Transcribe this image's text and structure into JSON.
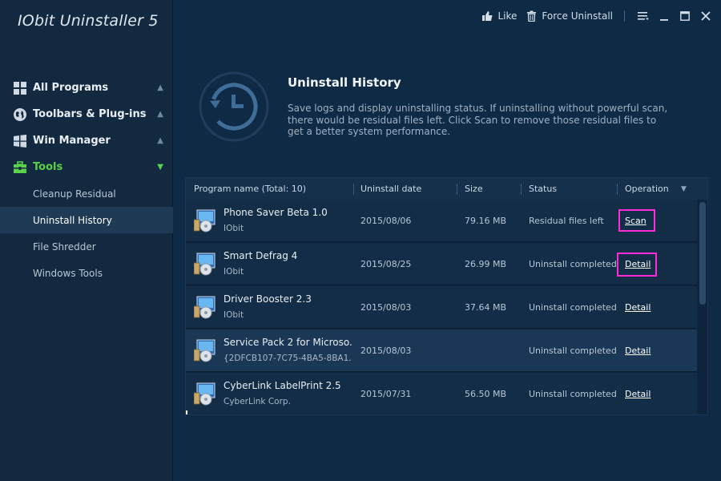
{
  "app": {
    "title": "IObit Uninstaller 5"
  },
  "topbar": {
    "like": "Like",
    "force_uninstall": "Force Uninstall"
  },
  "nav": {
    "items": [
      {
        "label": "All Programs",
        "icon": "windows-grid-icon",
        "arrow": "▲"
      },
      {
        "label": "Toolbars & Plug-ins",
        "icon": "globe-icon",
        "arrow": "▲"
      },
      {
        "label": "Win Manager",
        "icon": "windows-logo-icon",
        "arrow": "▲"
      },
      {
        "label": "Tools",
        "icon": "toolbox-icon",
        "arrow": "▼"
      }
    ],
    "sub_items": [
      {
        "label": "Cleanup Residual"
      },
      {
        "label": "Uninstall History"
      },
      {
        "label": "File Shredder"
      },
      {
        "label": "Windows Tools"
      }
    ]
  },
  "header": {
    "title": "Uninstall History",
    "description": "Save logs and display uninstalling status. If uninstalling without powerful scan, there would be residual files left. Click Scan to remove those residual files to get a better system performance."
  },
  "table": {
    "columns": [
      "Program name (Total: 10)",
      "Uninstall date",
      "Size",
      "Status",
      "Operation"
    ],
    "rows": [
      {
        "name": "Phone Saver Beta 1.0",
        "publisher": "IObit",
        "date": "2015/08/06",
        "size": "79.16 MB",
        "status": "Residual files left",
        "operation": "Scan"
      },
      {
        "name": "Smart Defrag 4",
        "publisher": "IObit",
        "date": "2015/08/25",
        "size": "26.99 MB",
        "status": "Uninstall completed",
        "operation": "Detail"
      },
      {
        "name": "Driver Booster 2.3",
        "publisher": "IObit",
        "date": "2015/08/03",
        "size": "37.64 MB",
        "status": "Uninstall completed",
        "operation": "Detail"
      },
      {
        "name": "Service Pack 2 for Microso...",
        "publisher": "{2DFCB107-7C75-4BA5-8BA1...",
        "date": "2015/08/03",
        "size": "",
        "status": "Uninstall completed",
        "operation": "Detail"
      },
      {
        "name": "CyberLink LabelPrint 2.5",
        "publisher": "CyberLink Corp.",
        "date": "2015/07/31",
        "size": "56.50 MB",
        "status": "Uninstall completed",
        "operation": "Detail"
      }
    ]
  },
  "colors": {
    "accent_green": "#58d24a",
    "highlight_magenta": "#ff2bd9",
    "background": "#0f2a45"
  }
}
